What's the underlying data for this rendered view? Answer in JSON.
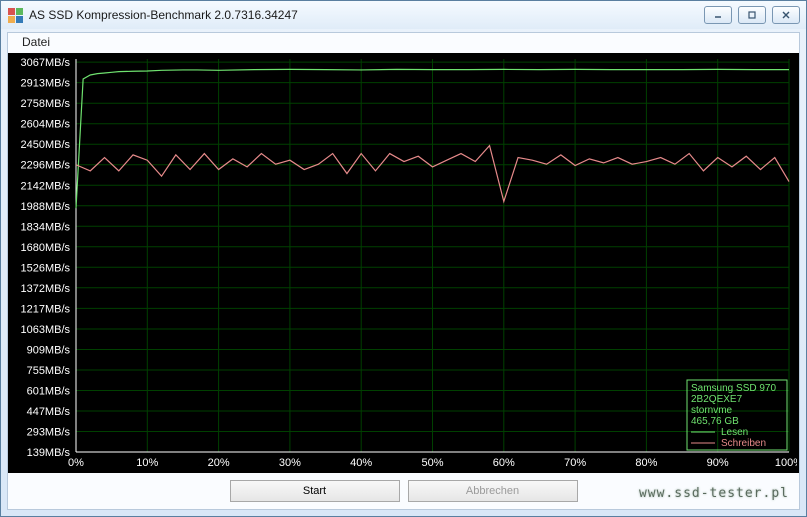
{
  "window": {
    "title": "AS SSD Kompression-Benchmark 2.0.7316.34247",
    "icon_colors": [
      "#d9534f",
      "#5cb85c",
      "#f0ad4e",
      "#337ab7"
    ]
  },
  "menu": {
    "datei": "Datei"
  },
  "buttons": {
    "start": "Start",
    "abort": "Abbrechen"
  },
  "legend": {
    "device_line1": "Samsung SSD 970",
    "device_line2": "2B2QEXE7",
    "device_line3": "stornvme",
    "device_line4": "465,76 GB",
    "read": "Lesen",
    "write": "Schreiben"
  },
  "watermark": "www.ssd-tester.pl",
  "chart_data": {
    "type": "line",
    "xlabel": "",
    "ylabel": "",
    "x_unit": "%",
    "y_unit": "MB/s",
    "y_ticks": [
      139,
      293,
      447,
      601,
      755,
      909,
      1063,
      1217,
      1372,
      1526,
      1680,
      1834,
      1988,
      2142,
      2296,
      2450,
      2604,
      2758,
      2913,
      3067
    ],
    "x_ticks": [
      0,
      10,
      20,
      30,
      40,
      50,
      60,
      70,
      80,
      90,
      100
    ],
    "xlim": [
      0,
      100
    ],
    "ylim": [
      139,
      3090
    ],
    "series": [
      {
        "name": "Lesen",
        "color": "#6fe26f",
        "x": [
          0,
          1,
          2,
          3,
          4,
          5,
          6,
          8,
          10,
          12,
          15,
          17,
          20,
          25,
          30,
          35,
          40,
          45,
          50,
          55,
          60,
          65,
          70,
          75,
          80,
          85,
          90,
          95,
          100
        ],
        "values": [
          1970,
          2940,
          2970,
          2980,
          2985,
          2990,
          2995,
          2998,
          3000,
          3005,
          3008,
          3008,
          3005,
          3010,
          3012,
          3010,
          3008,
          3012,
          3010,
          3010,
          3012,
          3010,
          3012,
          3010,
          3010,
          3010,
          3012,
          3010,
          3010
        ]
      },
      {
        "name": "Schreiben",
        "color": "#e68a8a",
        "x": [
          0,
          2,
          4,
          6,
          8,
          10,
          12,
          14,
          16,
          18,
          20,
          22,
          24,
          26,
          28,
          30,
          32,
          34,
          36,
          38,
          40,
          42,
          44,
          46,
          48,
          50,
          52,
          54,
          56,
          58,
          60,
          62,
          64,
          66,
          68,
          70,
          72,
          74,
          76,
          78,
          80,
          82,
          84,
          86,
          88,
          90,
          92,
          94,
          96,
          98,
          100
        ],
        "values": [
          2296,
          2250,
          2350,
          2250,
          2370,
          2330,
          2210,
          2370,
          2260,
          2380,
          2260,
          2340,
          2280,
          2380,
          2300,
          2330,
          2260,
          2300,
          2380,
          2230,
          2380,
          2250,
          2380,
          2320,
          2360,
          2280,
          2330,
          2380,
          2320,
          2440,
          2020,
          2350,
          2330,
          2300,
          2370,
          2290,
          2340,
          2310,
          2350,
          2300,
          2320,
          2350,
          2300,
          2380,
          2250,
          2350,
          2280,
          2360,
          2260,
          2350,
          2170
        ]
      }
    ]
  }
}
